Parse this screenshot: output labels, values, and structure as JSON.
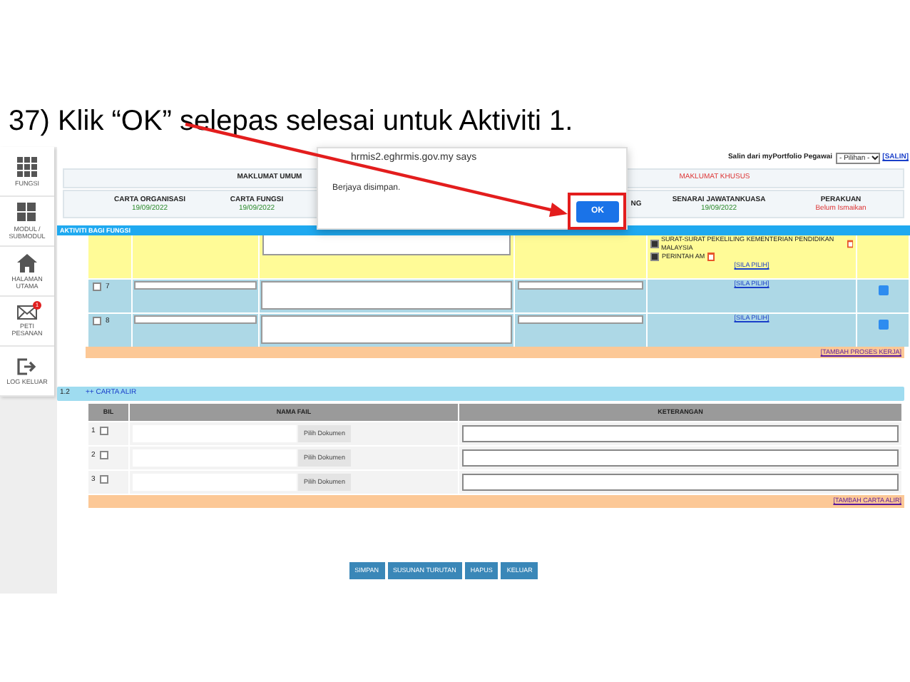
{
  "slide_title": "37) Klik “OK” selepas selesai untuk Aktiviti 1.",
  "sidebar": [
    {
      "label": "FUNGSI",
      "kind": "grid9"
    },
    {
      "label": "MODUL / SUBMODUL",
      "kind": "grid4"
    },
    {
      "label": "HALAMAN UTAMA",
      "kind": "home"
    },
    {
      "label": "PETI PESANAN",
      "kind": "mail",
      "badge": "1"
    },
    {
      "label": "LOG KELUAR",
      "kind": "logout"
    }
  ],
  "copy_from": {
    "label": "Salin dari myPortfolio Pegawai",
    "select": "- Pilihan -",
    "button": "[SALIN]"
  },
  "tabs": [
    {
      "label": "MAKLUMAT UMUM",
      "selected": true
    },
    {
      "label": "MAKLUMAT KHUSUS",
      "selected": false
    }
  ],
  "status_items": [
    {
      "title": "CARTA ORGANISASI",
      "value": "19/09/2022",
      "kind": "done"
    },
    {
      "title": "CARTA FUNGSI",
      "value": "19/09/2022",
      "kind": "done"
    },
    {
      "title": "NG",
      "kind": "partial"
    },
    {
      "title": "SENARAI JAWATANKUASA",
      "value": "19/09/2022",
      "kind": "done"
    },
    {
      "title": "PERAKUAN",
      "value": "Belum Ismaikan",
      "kind": "pending"
    }
  ],
  "dialog": {
    "title": "hrmis2.eghrmis.gov.my says",
    "message": "Berjaya disimpan.",
    "button": "OK"
  },
  "activity": {
    "title": "AKTIVITI BAGI FUNGSI",
    "documents": [
      {
        "label": "SURAT-SURAT PEKELILING KEMENTERIAN PENDIDIKAN MALAYSIA",
        "checked": true
      },
      {
        "label": "PERINTAH AM",
        "checked": true
      }
    ],
    "documents_link": "[SILA PILIH]",
    "rows": [
      {
        "number": "7",
        "checked": false,
        "link": "[SILA PILIH]"
      },
      {
        "number": "8",
        "checked": false,
        "link": "[SILA PILIH]"
      }
    ],
    "add_link": "[TAMBAH PROSES KERJA]"
  },
  "flowchart": {
    "number": "1.2",
    "title": "++ CARTA ALIR",
    "columns": [
      "BIL",
      "NAMA FAIL",
      "KETERANGAN"
    ],
    "rows": [
      {
        "number": "1",
        "checked": false,
        "button": "Pilih Dokumen"
      },
      {
        "number": "2",
        "checked": false,
        "button": "Pilih Dokumen"
      },
      {
        "number": "3",
        "checked": false,
        "button": "Pilih Dokumen"
      }
    ],
    "add_link": "[TAMBAH CARTA ALIR]"
  },
  "buttons": [
    "SIMPAN",
    "SUSUNAN TURUTAN",
    "HAPUS",
    "KELUAR"
  ]
}
